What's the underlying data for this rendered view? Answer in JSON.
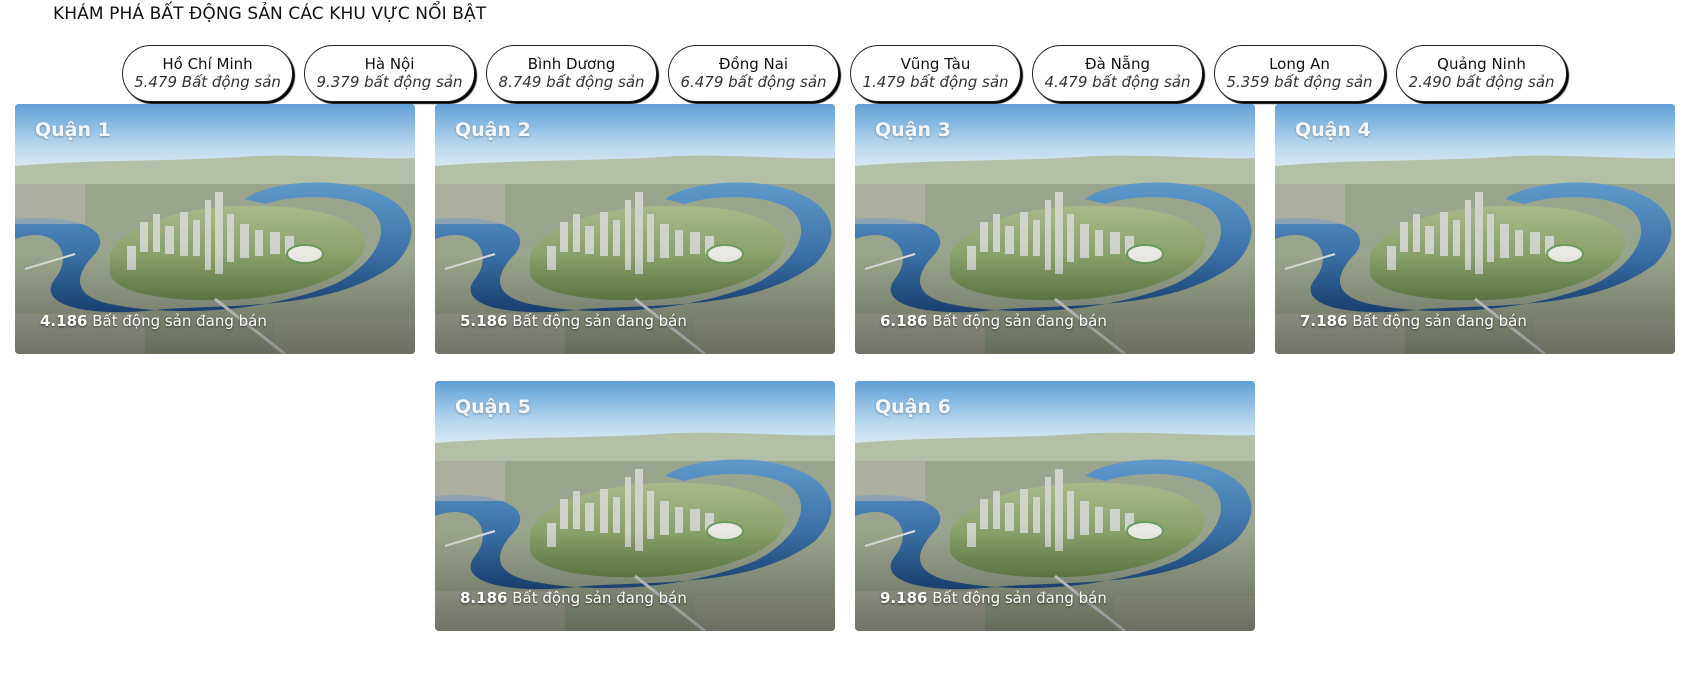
{
  "page": {
    "heading": "KHÁM PHÁ BẤT ĐỘNG SẢN CÁC KHU VỰC NỔI BẬT"
  },
  "region_tabs": [
    {
      "name": "Hồ Chí Minh",
      "count": "5.479 Bất động sản"
    },
    {
      "name": "Hà Nội",
      "count": "9.379 bất động sản"
    },
    {
      "name": "Bình Dương",
      "count": "8.749 bất động sản"
    },
    {
      "name": "Đồng Nai",
      "count": "6.479 bất động sản"
    },
    {
      "name": "Vũng Tàu",
      "count": "1.479 bất động sản"
    },
    {
      "name": "Đà Nẵng",
      "count": "4.479 bất động sản"
    },
    {
      "name": "Long An",
      "count": "5.359 bất động sản"
    },
    {
      "name": "Quảng Ninh",
      "count": "2.490 bất động sản"
    }
  ],
  "district_cards": [
    {
      "name": "Quận 1",
      "listing_count": "4.186",
      "listing_label": "Bất động sản đang bán"
    },
    {
      "name": "Quận 2",
      "listing_count": "5.186",
      "listing_label": "Bất động sản đang bán"
    },
    {
      "name": "Quận 3",
      "listing_count": "6.186",
      "listing_label": "Bất động sản đang bán"
    },
    {
      "name": "Quận 4",
      "listing_count": "7.186",
      "listing_label": "Bất động sản đang bán"
    },
    {
      "name": "Quận 5",
      "listing_count": "8.186",
      "listing_label": "Bất động sản đang bán"
    },
    {
      "name": "Quận 6",
      "listing_count": "9.186",
      "listing_label": "Bất động sản đang bán"
    }
  ],
  "colors": {
    "sky": "#8fc2e6",
    "river": "#2f6fae",
    "land": "#8da560",
    "city": "#c9ccc8"
  },
  "image": {
    "subject": "aerial-city-river-render"
  }
}
